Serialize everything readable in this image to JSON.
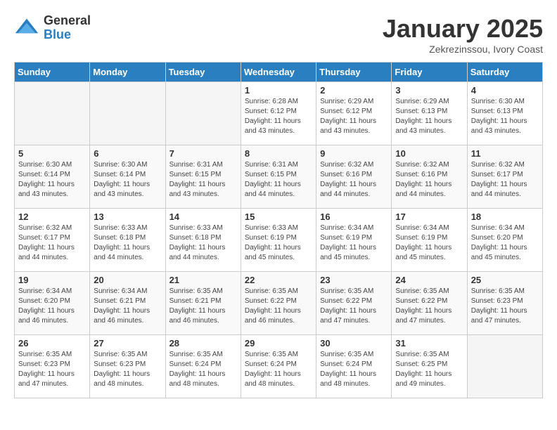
{
  "logo": {
    "general": "General",
    "blue": "Blue"
  },
  "header": {
    "title": "January 2025",
    "location": "Zekrezinssou, Ivory Coast"
  },
  "days_of_week": [
    "Sunday",
    "Monday",
    "Tuesday",
    "Wednesday",
    "Thursday",
    "Friday",
    "Saturday"
  ],
  "weeks": [
    [
      {
        "day": "",
        "info": ""
      },
      {
        "day": "",
        "info": ""
      },
      {
        "day": "",
        "info": ""
      },
      {
        "day": "1",
        "info": "Sunrise: 6:28 AM\nSunset: 6:12 PM\nDaylight: 11 hours and 43 minutes."
      },
      {
        "day": "2",
        "info": "Sunrise: 6:29 AM\nSunset: 6:12 PM\nDaylight: 11 hours and 43 minutes."
      },
      {
        "day": "3",
        "info": "Sunrise: 6:29 AM\nSunset: 6:13 PM\nDaylight: 11 hours and 43 minutes."
      },
      {
        "day": "4",
        "info": "Sunrise: 6:30 AM\nSunset: 6:13 PM\nDaylight: 11 hours and 43 minutes."
      }
    ],
    [
      {
        "day": "5",
        "info": "Sunrise: 6:30 AM\nSunset: 6:14 PM\nDaylight: 11 hours and 43 minutes."
      },
      {
        "day": "6",
        "info": "Sunrise: 6:30 AM\nSunset: 6:14 PM\nDaylight: 11 hours and 43 minutes."
      },
      {
        "day": "7",
        "info": "Sunrise: 6:31 AM\nSunset: 6:15 PM\nDaylight: 11 hours and 43 minutes."
      },
      {
        "day": "8",
        "info": "Sunrise: 6:31 AM\nSunset: 6:15 PM\nDaylight: 11 hours and 44 minutes."
      },
      {
        "day": "9",
        "info": "Sunrise: 6:32 AM\nSunset: 6:16 PM\nDaylight: 11 hours and 44 minutes."
      },
      {
        "day": "10",
        "info": "Sunrise: 6:32 AM\nSunset: 6:16 PM\nDaylight: 11 hours and 44 minutes."
      },
      {
        "day": "11",
        "info": "Sunrise: 6:32 AM\nSunset: 6:17 PM\nDaylight: 11 hours and 44 minutes."
      }
    ],
    [
      {
        "day": "12",
        "info": "Sunrise: 6:32 AM\nSunset: 6:17 PM\nDaylight: 11 hours and 44 minutes."
      },
      {
        "day": "13",
        "info": "Sunrise: 6:33 AM\nSunset: 6:18 PM\nDaylight: 11 hours and 44 minutes."
      },
      {
        "day": "14",
        "info": "Sunrise: 6:33 AM\nSunset: 6:18 PM\nDaylight: 11 hours and 44 minutes."
      },
      {
        "day": "15",
        "info": "Sunrise: 6:33 AM\nSunset: 6:19 PM\nDaylight: 11 hours and 45 minutes."
      },
      {
        "day": "16",
        "info": "Sunrise: 6:34 AM\nSunset: 6:19 PM\nDaylight: 11 hours and 45 minutes."
      },
      {
        "day": "17",
        "info": "Sunrise: 6:34 AM\nSunset: 6:19 PM\nDaylight: 11 hours and 45 minutes."
      },
      {
        "day": "18",
        "info": "Sunrise: 6:34 AM\nSunset: 6:20 PM\nDaylight: 11 hours and 45 minutes."
      }
    ],
    [
      {
        "day": "19",
        "info": "Sunrise: 6:34 AM\nSunset: 6:20 PM\nDaylight: 11 hours and 46 minutes."
      },
      {
        "day": "20",
        "info": "Sunrise: 6:34 AM\nSunset: 6:21 PM\nDaylight: 11 hours and 46 minutes."
      },
      {
        "day": "21",
        "info": "Sunrise: 6:35 AM\nSunset: 6:21 PM\nDaylight: 11 hours and 46 minutes."
      },
      {
        "day": "22",
        "info": "Sunrise: 6:35 AM\nSunset: 6:22 PM\nDaylight: 11 hours and 46 minutes."
      },
      {
        "day": "23",
        "info": "Sunrise: 6:35 AM\nSunset: 6:22 PM\nDaylight: 11 hours and 47 minutes."
      },
      {
        "day": "24",
        "info": "Sunrise: 6:35 AM\nSunset: 6:22 PM\nDaylight: 11 hours and 47 minutes."
      },
      {
        "day": "25",
        "info": "Sunrise: 6:35 AM\nSunset: 6:23 PM\nDaylight: 11 hours and 47 minutes."
      }
    ],
    [
      {
        "day": "26",
        "info": "Sunrise: 6:35 AM\nSunset: 6:23 PM\nDaylight: 11 hours and 47 minutes."
      },
      {
        "day": "27",
        "info": "Sunrise: 6:35 AM\nSunset: 6:23 PM\nDaylight: 11 hours and 48 minutes."
      },
      {
        "day": "28",
        "info": "Sunrise: 6:35 AM\nSunset: 6:24 PM\nDaylight: 11 hours and 48 minutes."
      },
      {
        "day": "29",
        "info": "Sunrise: 6:35 AM\nSunset: 6:24 PM\nDaylight: 11 hours and 48 minutes."
      },
      {
        "day": "30",
        "info": "Sunrise: 6:35 AM\nSunset: 6:24 PM\nDaylight: 11 hours and 48 minutes."
      },
      {
        "day": "31",
        "info": "Sunrise: 6:35 AM\nSunset: 6:25 PM\nDaylight: 11 hours and 49 minutes."
      },
      {
        "day": "",
        "info": ""
      }
    ]
  ]
}
